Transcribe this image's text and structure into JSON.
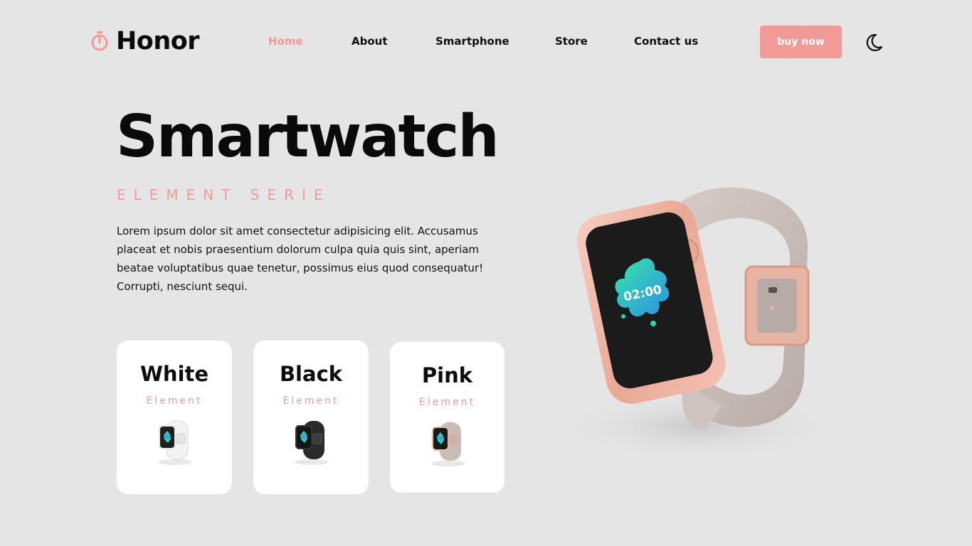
{
  "brand": {
    "name": "Honor",
    "icon": "stopwatch-icon",
    "accent": "#f29a98"
  },
  "nav": {
    "items": [
      {
        "label": "Home",
        "active": true
      },
      {
        "label": "About",
        "active": false
      },
      {
        "label": "Smartphone",
        "active": false
      },
      {
        "label": "Store",
        "active": false
      },
      {
        "label": "Contact us",
        "active": false
      }
    ]
  },
  "header": {
    "buy_label": "buy now",
    "theme_icon": "moon-icon"
  },
  "hero": {
    "title": "Smartwatch",
    "subtitle": "ELEMENT SERIE",
    "description": "Lorem ipsum dolor sit amet consectetur adipisicing elit. Accusamus placeat et nobis praesentium dolorum culpa quia quis sint, aperiam beatae voluptatibus quae tenetur, possimus eius quod consequatur! Corrupti, nesciunt sequi."
  },
  "watch_screen": {
    "time": "02:00"
  },
  "cards": [
    {
      "title": "White",
      "subtitle": "Element",
      "strap_color": "#f4f4f4"
    },
    {
      "title": "Black",
      "subtitle": "Element",
      "strap_color": "#2a2a2a"
    },
    {
      "title": "Pink",
      "subtitle": "Element",
      "strap_color": "#c9bcb8"
    }
  ],
  "colors": {
    "background": "#e5e5e6",
    "accent": "#f29a98",
    "text": "#0d0d0d"
  }
}
